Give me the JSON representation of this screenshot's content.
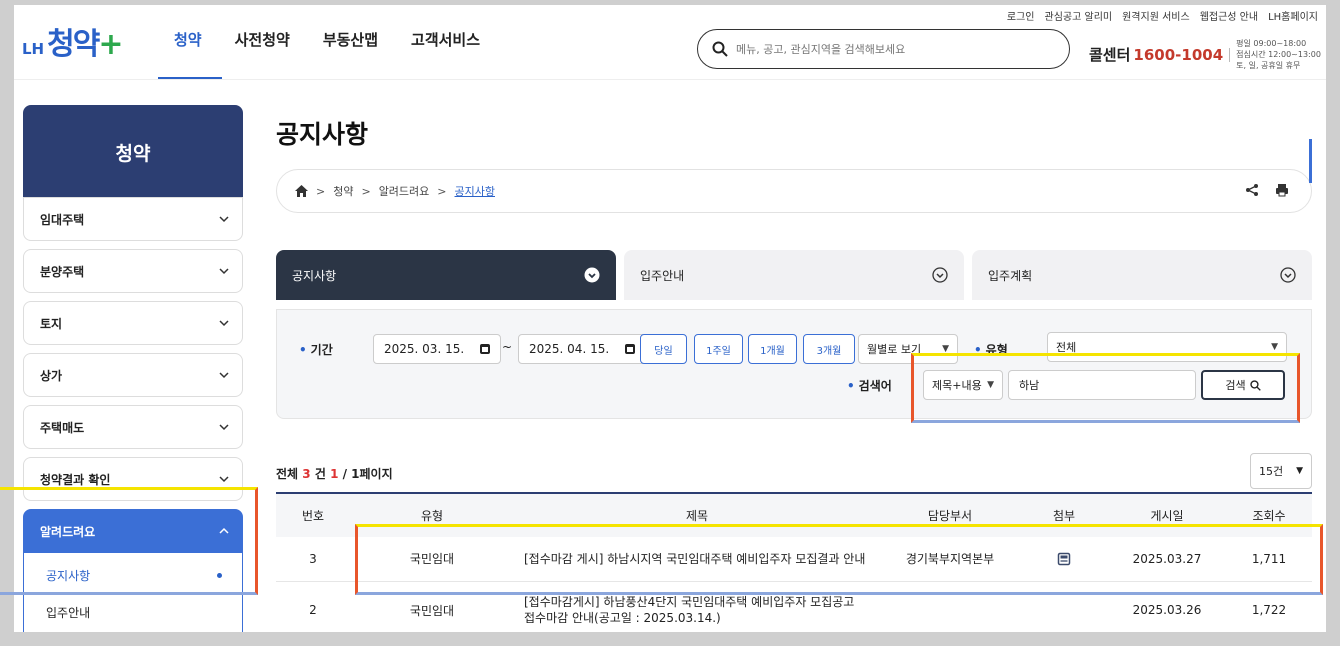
{
  "utility_links": [
    "로그인",
    "관심공고 알리미",
    "원격지원 서비스",
    "웹접근성 안내",
    "LH홈페이지"
  ],
  "logo": {
    "lh": "LH",
    "name": "청약",
    "plus": "+"
  },
  "gnb": [
    {
      "label": "청약",
      "active": true
    },
    {
      "label": "사전청약",
      "active": false
    },
    {
      "label": "부동산맵",
      "active": false
    },
    {
      "label": "고객서비스",
      "active": false
    }
  ],
  "search": {
    "placeholder": "메뉴, 공고, 관심지역을 검색해보세요"
  },
  "callcenter": {
    "label": "콜센터",
    "number": "1600-1004",
    "hours": [
      "평일 09:00~18:00",
      "점심시간 12:00~13:00",
      "토, 일, 공휴일 휴무"
    ]
  },
  "sidebar": {
    "title": "청약",
    "items": [
      "임대주택",
      "분양주택",
      "토지",
      "상가",
      "주택매도",
      "청약결과 확인"
    ],
    "open_item": "알려드려요",
    "sub_items": [
      "공지사항",
      "입주안내"
    ]
  },
  "page": {
    "title": "공지사항"
  },
  "breadcrumb": [
    "청약",
    "알려드려요",
    "공지사항"
  ],
  "tabs": [
    {
      "label": "공지사항",
      "active": true
    },
    {
      "label": "입주안내",
      "active": false
    },
    {
      "label": "입주계획",
      "active": false
    }
  ],
  "filter": {
    "period_label": "기간",
    "date_from": "2025. 03. 15.",
    "date_sep": "~",
    "date_to": "2025. 04. 15.",
    "period_buttons": [
      "당일",
      "1주일",
      "1개월",
      "3개월"
    ],
    "view_select": "월별로 보기",
    "type_label": "유형",
    "type_value": "전체",
    "keyword_label": "검색어",
    "keyword_scope": "제목+내용",
    "keyword_value": "하남",
    "search_button": "검색"
  },
  "summary": {
    "prefix": "전체",
    "count": "3",
    "unit": "건",
    "page": "1",
    "pages": "/ 1페이지"
  },
  "page_size": "15건",
  "table": {
    "headers": [
      "번호",
      "유형",
      "제목",
      "담당부서",
      "첨부",
      "게시일",
      "조회수"
    ],
    "rows": [
      {
        "no": "3",
        "type": "국민임대",
        "title_line1": "[접수마감 게시] 하남시지역 국민임대주택 예비입주자 모집결과 안내",
        "title_line2": "",
        "dept": "경기북부지역본부",
        "attach": true,
        "date": "2025.03.27",
        "views": "1,711"
      },
      {
        "no": "2",
        "type": "국민임대",
        "title_line1": "[접수마감게시] 하남풍산4단지 국민임대주택 예비입주자 모집공고",
        "title_line2": "접수마감 안내(공고일 : 2025.03.14.)",
        "dept": "",
        "attach": false,
        "date": "2025.03.26",
        "views": "1,722"
      }
    ]
  },
  "colors": {
    "brand_blue": "#2a61c8",
    "brand_navy": "#2c3e72",
    "phone_red": "#c43a2c",
    "highlight_yellow": "#f5e400",
    "highlight_orange": "#e8562b"
  }
}
